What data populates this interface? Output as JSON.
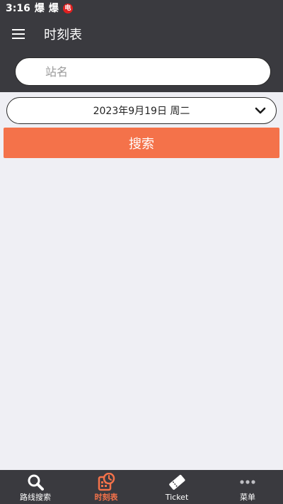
{
  "status_bar": {
    "time": "3:16",
    "notifications": [
      "爆",
      "爆",
      "电"
    ]
  },
  "app_bar": {
    "title": "时刻表"
  },
  "search": {
    "placeholder": "站名"
  },
  "date_selector": {
    "value": "2023年9月19日 周二"
  },
  "search_button": {
    "label": "搜索"
  },
  "bottom_nav": {
    "items": [
      {
        "label": "路线搜索",
        "icon": "search-icon"
      },
      {
        "label": "时刻表",
        "icon": "timetable-icon",
        "active": true
      },
      {
        "label": "Ticket",
        "icon": "ticket-icon"
      },
      {
        "label": "菜单",
        "icon": "more-icon"
      }
    ]
  },
  "colors": {
    "header": "#3a3a3f",
    "accent": "#f4724a",
    "background": "#efeff4"
  }
}
